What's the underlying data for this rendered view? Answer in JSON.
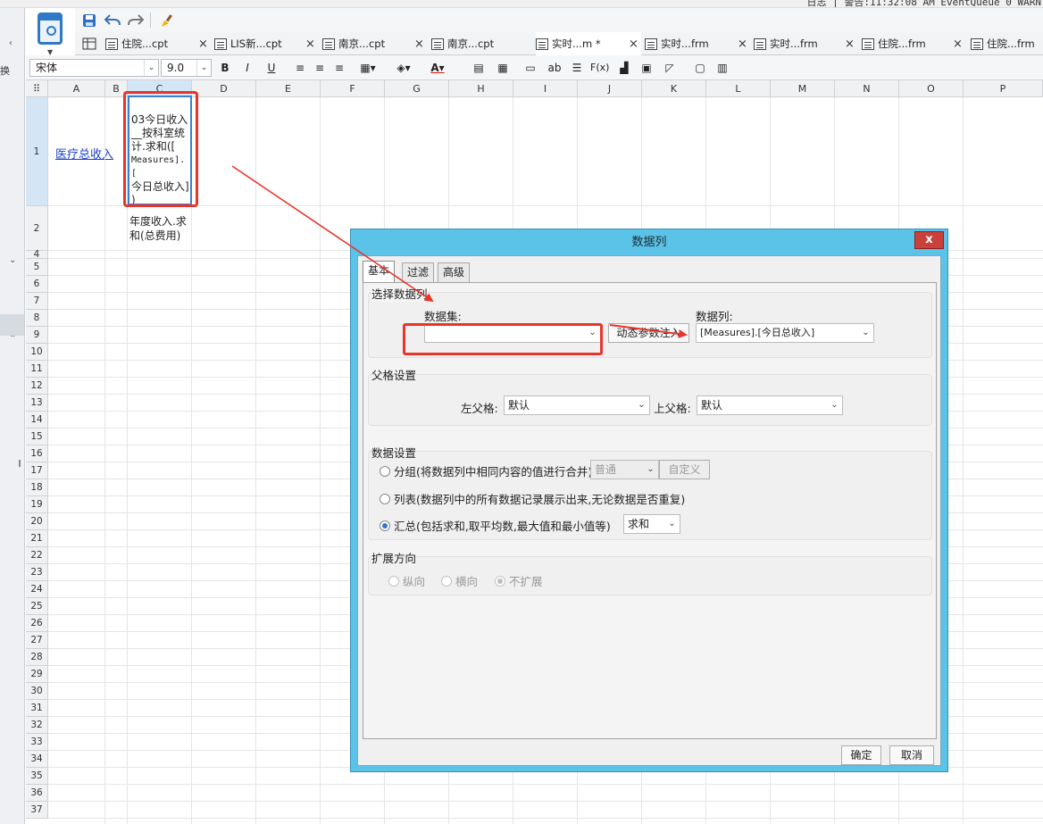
{
  "system_bar": {
    "status_text": "日志 | 警告:11:32:08 AM EventQueue 0 WARN"
  },
  "left_panel": {
    "label": "换"
  },
  "toolbar1": {
    "save_icon": "save-icon",
    "undo_icon": "undo-icon",
    "redo_icon": "redo-icon",
    "brush_icon": "format-brush-icon"
  },
  "tabs": [
    {
      "label": "住院...cpt",
      "close": "×",
      "active": false
    },
    {
      "label": "LIS新...cpt",
      "close": "×",
      "active": false
    },
    {
      "label": "南京...cpt",
      "close": "×",
      "active": false
    },
    {
      "label": "南京...cpt",
      "close": "",
      "active": false
    },
    {
      "label": "实时...m *",
      "close": "×",
      "active": true
    },
    {
      "label": "实时...frm",
      "close": "×",
      "active": false
    },
    {
      "label": "实时...frm",
      "close": "×",
      "active": false
    },
    {
      "label": "住院...frm",
      "close": "×",
      "active": false
    },
    {
      "label": "住院...frm",
      "close": "",
      "active": false
    }
  ],
  "format_toolbar": {
    "font_name": "宋体",
    "font_size": "9.0",
    "bold": "B",
    "italic": "I",
    "underline": "U",
    "text_icon": "ab",
    "formula_icon": "F(x)"
  },
  "sheet": {
    "columns": [
      "A",
      "B",
      "C",
      "D",
      "E",
      "F",
      "G",
      "H",
      "I",
      "J",
      "K",
      "L",
      "M",
      "N",
      "O",
      "P"
    ],
    "rows": [
      "1",
      "2",
      "4",
      "5",
      "6",
      "7",
      "8",
      "9",
      "10",
      "11",
      "12",
      "13",
      "14",
      "15",
      "16",
      "17",
      "18",
      "19",
      "20",
      "21",
      "22",
      "23",
      "24",
      "25",
      "26",
      "27",
      "28",
      "29",
      "30",
      "31",
      "32",
      "33",
      "34",
      "35",
      "36",
      "37"
    ],
    "selected_column": "C",
    "selected_row": "1",
    "cell_A1": "医疗总收入",
    "cell_C1_line1": "03今日收入__按科室统计.求和([",
    "cell_C1_line2": "Measures].[",
    "cell_C1_line3": "今日总收入]",
    "cell_C1_line4": ")",
    "cell_C2": "年度收入.求和(总费用)"
  },
  "dialog": {
    "title": "数据列",
    "close_label": "x",
    "tabs": [
      "基本",
      "过滤",
      "高级"
    ],
    "active_tab": "基本",
    "section_select": "选择数据列",
    "dataset_label": "数据集:",
    "dataset_value": "",
    "dynamic_param_button": "动态参数注入",
    "column_label": "数据列:",
    "column_value": "[Measures].[今日总收入]",
    "section_parent": "父格设置",
    "left_parent_label": "左父格:",
    "left_parent_value": "默认",
    "top_parent_label": "上父格:",
    "top_parent_value": "默认",
    "section_data": "数据设置",
    "radio_group": "分组(将数据列中相同内容的值进行合并)",
    "group_mode_value": "普通",
    "custom_button": "自定义",
    "radio_list": "列表(数据列中的所有数据记录展示出来,无论数据是否重复)",
    "radio_summary": "汇总(包括求和,取平均数,最大值和最小值等)",
    "summary_value": "求和",
    "selected_data_setting": "汇总",
    "section_expand": "扩展方向",
    "expand_vertical": "纵向",
    "expand_horizontal": "横向",
    "expand_none": "不扩展",
    "selected_expand": "不扩展",
    "ok_button": "确定",
    "cancel_button": "取消"
  },
  "colors": {
    "accent_blue": "#5bc3e8",
    "annotation_red": "#e8352b",
    "selection_blue": "#3a7fd0",
    "link_blue": "#1a3fc8"
  }
}
